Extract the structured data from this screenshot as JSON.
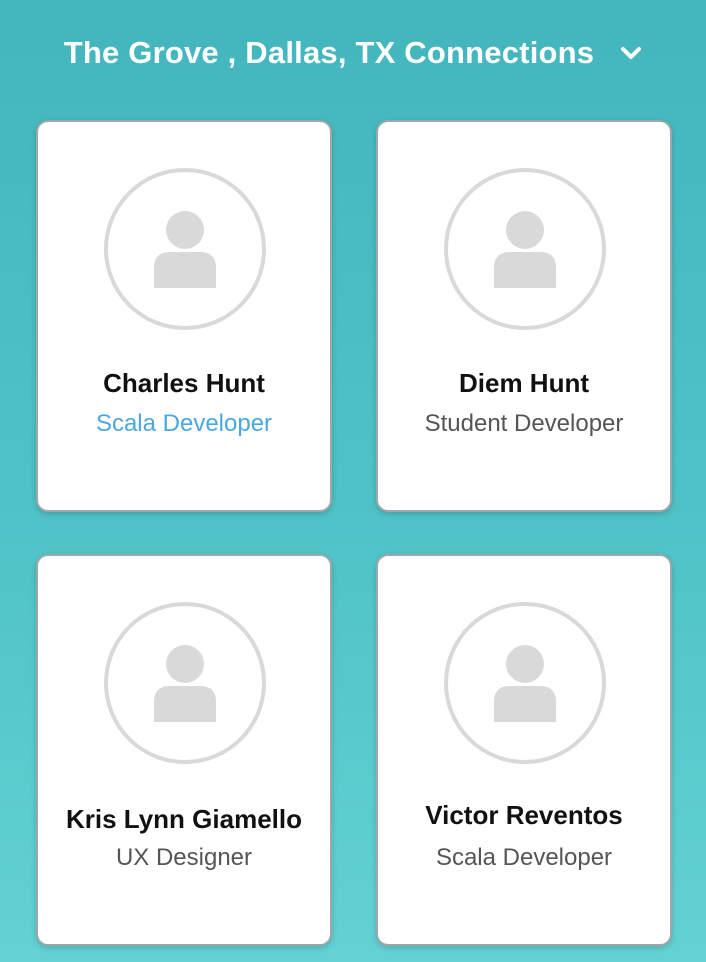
{
  "header": {
    "title": "The Grove , Dallas, TX Connections",
    "toggle_icon": "chevron-down-icon"
  },
  "cards": [
    {
      "name": "Charles Hunt",
      "role": "Scala Developer",
      "avatar_icon": "user-placeholder-icon",
      "role_color": "#4aa8e0"
    },
    {
      "name": "Diem Hunt",
      "role": "Student Developer",
      "avatar_icon": "user-placeholder-icon",
      "role_color": "#555555"
    },
    {
      "name": "Kris Lynn Giamello",
      "role": "UX Designer",
      "avatar_icon": "user-placeholder-icon",
      "role_color": "#555555"
    },
    {
      "name": "Victor Reventos",
      "role": "Scala Developer",
      "avatar_icon": "user-placeholder-icon",
      "role_color": "#555555"
    }
  ],
  "colors": {
    "background_top": "#43b6bd",
    "background_bottom": "#63d2d4",
    "card": "#ffffff",
    "avatar_gray": "#d9d9d9"
  }
}
